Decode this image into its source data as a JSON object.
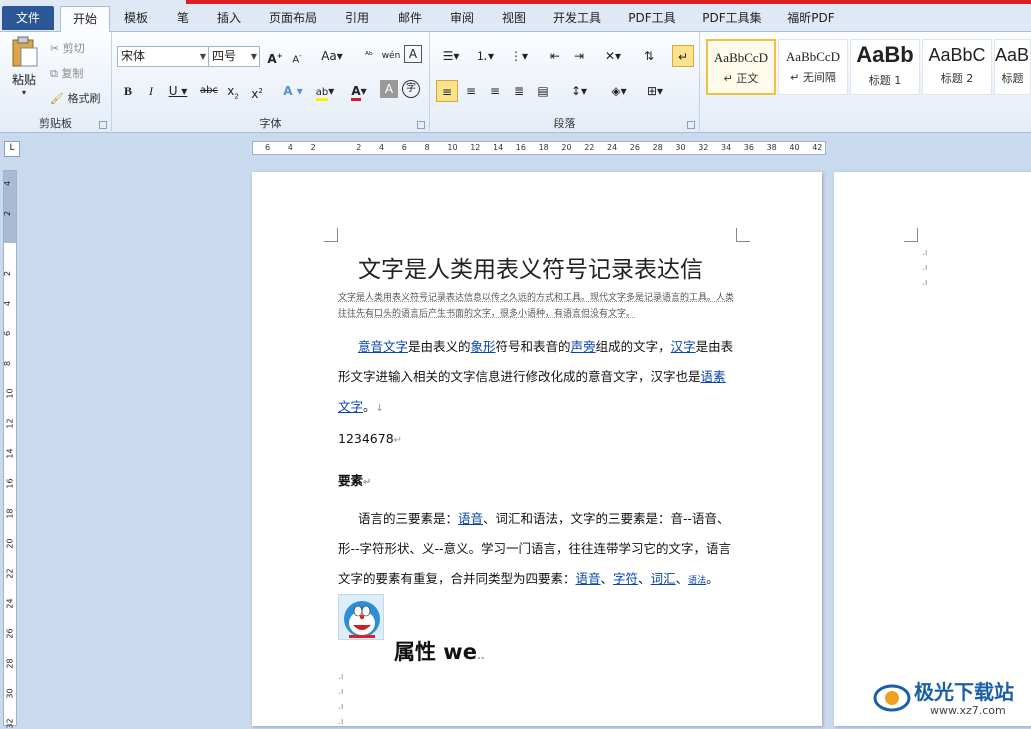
{
  "tabs": [
    "文件",
    "开始",
    "模板",
    "笔",
    "插入",
    "页面布局",
    "引用",
    "邮件",
    "审阅",
    "视图",
    "开发工具",
    "PDF工具",
    "PDF工具集",
    "福昕PDF"
  ],
  "clipboard": {
    "paste": "粘贴",
    "cut": "剪切",
    "copy": "复制",
    "format_painter": "格式刷",
    "group_label": "剪贴板"
  },
  "font": {
    "font_name": "宋体",
    "font_size": "四号",
    "group_label": "字体"
  },
  "paragraph": {
    "group_label": "段落"
  },
  "styles": [
    {
      "preview": "AaBbCcD",
      "name": "↵ 正文"
    },
    {
      "preview": "AaBbCcD",
      "name": "↵ 无间隔"
    },
    {
      "preview": "AaBb",
      "name": "标题 1"
    },
    {
      "preview": "AaBbC",
      "name": "标题 2"
    },
    {
      "preview": "AaBb",
      "name": "标题"
    }
  ],
  "ruler": {
    "h_numbers": [
      "6",
      "4",
      "2",
      "",
      "2",
      "4",
      "6",
      "8",
      "10",
      "12",
      "14",
      "16",
      "18",
      "20",
      "22",
      "24",
      "26",
      "28",
      "30",
      "32",
      "34",
      "36",
      "38",
      "40",
      "42"
    ],
    "v_numbers": [
      "4",
      "2",
      "",
      "2",
      "4",
      "6",
      "8",
      "10",
      "12",
      "14",
      "16",
      "18",
      "20",
      "22",
      "24",
      "26",
      "28",
      "30",
      "32"
    ]
  },
  "document": {
    "title": "文字是人类用表义符号记录表达信",
    "subtitle": "文字是人类用表义符号记录表达信息以传之久远的方式和工具。现代文字多是记录语言的工具。人类往往先有口头的语言后产生书面的文字，很多小语种，有语言但没有文字。",
    "para1": {
      "l1": "意音文字",
      "t1": "是由表义的",
      "l2": "象形",
      "t2": "符号和表音的",
      "l3": "声旁",
      "t3": "组成的文字，",
      "l4": "汉字",
      "t4": "是由表形文字进输入相关的文字信息进行修改化成的意音文字，汉字也是",
      "l5": "语素文字",
      "t5": "。"
    },
    "numbers": "1234678",
    "section": "要素",
    "para2": {
      "t1": "语言的三要素是：",
      "l1": "语音",
      "t2": "、词汇和语法，文字的三要素是：音--语音、形--字符形状、义--意义。学习一门语言，往往连带学习它的文字，语言文字的要素有重复，合并同类型为四要素：",
      "l2": "语音",
      "t3": "、",
      "l3": "字符",
      "t4": "、",
      "l4": "词汇",
      "t5": "、",
      "l5": "语法",
      "t6": "。"
    },
    "heading2": "属性 we"
  },
  "watermark": {
    "text": "极光下载站",
    "url": "www.xz7.com"
  }
}
